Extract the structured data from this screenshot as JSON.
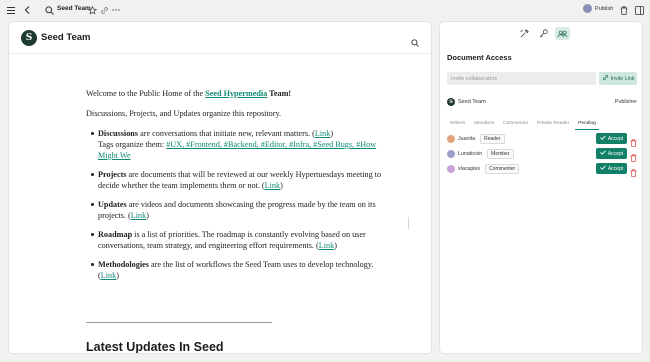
{
  "topbar": {
    "title": "Seed Team",
    "publish_label": "Publish",
    "icons": [
      "menu-icon",
      "back-icon",
      "search-icon",
      "star-icon",
      "link-icon",
      "more-icon",
      "trash-icon",
      "panel-toggle-icon"
    ]
  },
  "main": {
    "site_title": "Seed Team",
    "logo_letter": "S",
    "intro": {
      "prefix": "Welcome to the Public Home of the ",
      "link": "Seed Hypermedia",
      "suffix": " Team!"
    },
    "subtitle": "Discussions, Projects, and Updates organize this repository.",
    "items": [
      {
        "term": "Discussions",
        "text": " are conversations that initiate new, relevant matters. (",
        "link": "Link",
        "close": ")",
        "tags_prefix": "Tags organize them: ",
        "tags": "#UX, #Frontend, #Backend, #Editor, #Infra, #Seed Bugs, #How Might We"
      },
      {
        "term": "Projects",
        "text": " are documents that will be reviewed at our weekly Hypertuesdays meeting to decide whether the team implements them or not. (",
        "link": "Link",
        "close": ")"
      },
      {
        "term": "Updates",
        "text": " are videos and documents showcasing the progress made by the team on its projects. (",
        "link": "Link",
        "close": ")"
      },
      {
        "term": "Roadmap",
        "text": " is a list of priorities. The roadmap is constantly evolving based on user conversations, team strategy, and engineering effort requirements. (",
        "link": "Link",
        "close": ")"
      },
      {
        "term": "Methodologies",
        "text": " are the list of workflows the Seed Team uses to develop technology. (",
        "link": "Link",
        "close": ")"
      }
    ],
    "section_heading": "Latest Updates In Seed"
  },
  "side": {
    "title": "Document Access",
    "invite_placeholder": "Invite collaborators",
    "invite_button": "Invite Link",
    "owner": {
      "name": "Seed Team",
      "role": "Publisher",
      "logo_letter": "S"
    },
    "perm_tabs": [
      "Writers",
      "Members",
      "Commentor",
      "Private Reader",
      "Pending"
    ],
    "active_tab": "Pending",
    "pending": [
      {
        "name": "Juanita",
        "role": "Reader",
        "avatar_color": "#e0a47c"
      },
      {
        "name": "Lunaticoin",
        "role": "Member",
        "avatar_color": "#9a9ec9"
      },
      {
        "name": "xlacaples",
        "role": "Commenter",
        "avatar_color": "#c9a4d8"
      }
    ],
    "accept_label": "Accept"
  },
  "colors": {
    "accent": "#128067",
    "link": "#0f8a74",
    "danger": "#d9534f"
  }
}
